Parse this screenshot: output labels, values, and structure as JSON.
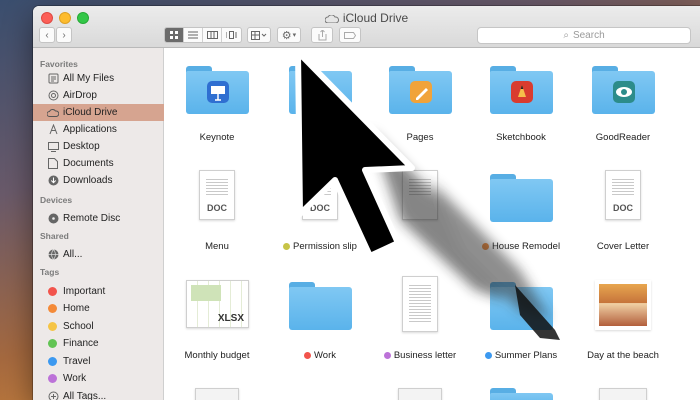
{
  "window": {
    "title": "iCloud Drive"
  },
  "toolbar": {
    "search_placeholder": "Search"
  },
  "sidebar": {
    "sections": [
      {
        "title": "Favorites",
        "items": [
          {
            "label": "All My Files",
            "icon": "all-files-icon"
          },
          {
            "label": "AirDrop",
            "icon": "airdrop-icon"
          },
          {
            "label": "iCloud Drive",
            "icon": "cloud-icon",
            "selected": true
          },
          {
            "label": "Applications",
            "icon": "applications-icon"
          },
          {
            "label": "Desktop",
            "icon": "desktop-icon"
          },
          {
            "label": "Documents",
            "icon": "documents-icon"
          },
          {
            "label": "Downloads",
            "icon": "downloads-icon"
          }
        ]
      },
      {
        "title": "Devices",
        "items": [
          {
            "label": "Remote Disc",
            "icon": "disc-icon"
          }
        ]
      },
      {
        "title": "Shared",
        "items": [
          {
            "label": "All...",
            "icon": "globe-icon"
          }
        ]
      },
      {
        "title": "Tags",
        "items": [
          {
            "label": "Important",
            "color": "#f2544c"
          },
          {
            "label": "Home",
            "color": "#f48a38"
          },
          {
            "label": "School",
            "color": "#f5c445"
          },
          {
            "label": "Finance",
            "color": "#62c454"
          },
          {
            "label": "Travel",
            "color": "#3c99f0"
          },
          {
            "label": "Work",
            "color": "#bc72d8"
          },
          {
            "label": "All Tags...",
            "icon": "tags-icon"
          }
        ]
      }
    ]
  },
  "files": {
    "row1": [
      {
        "label": "Keynote",
        "kind": "folder",
        "badge": "keynote"
      },
      {
        "label": "",
        "kind": "folder",
        "badge": ""
      },
      {
        "label": "Pages",
        "kind": "folder",
        "badge": "pages"
      },
      {
        "label": "Sketchbook",
        "kind": "folder",
        "badge": "sketchbook"
      },
      {
        "label": "GoodReader",
        "kind": "folder",
        "badge": "goodreader"
      }
    ],
    "row2": [
      {
        "label": "Menu",
        "kind": "doc",
        "ext": "DOC"
      },
      {
        "label": "Permission slip",
        "kind": "doc",
        "ext": "DOC",
        "tag": "#c7c447"
      },
      {
        "label": "",
        "kind": "doc",
        "ext": ""
      },
      {
        "label": "House Remodel",
        "kind": "folder",
        "tag": "#f48a38"
      },
      {
        "label": "Cover Letter",
        "kind": "doc",
        "ext": "DOC"
      }
    ],
    "row3": [
      {
        "label": "Monthly budget",
        "kind": "sheet",
        "ext": "XLSX"
      },
      {
        "label": "Work",
        "kind": "folder",
        "tag": "#f2544c"
      },
      {
        "label": "Business letter",
        "kind": "letter",
        "tag": "#bc72d8"
      },
      {
        "label": "Summer Plans",
        "kind": "folder",
        "tag": "#3c99f0"
      },
      {
        "label": "Day at the beach",
        "kind": "photo"
      }
    ]
  },
  "colors": {
    "selection": "#d6a490",
    "folder": "#6bbdf0",
    "accent": "#000000"
  }
}
